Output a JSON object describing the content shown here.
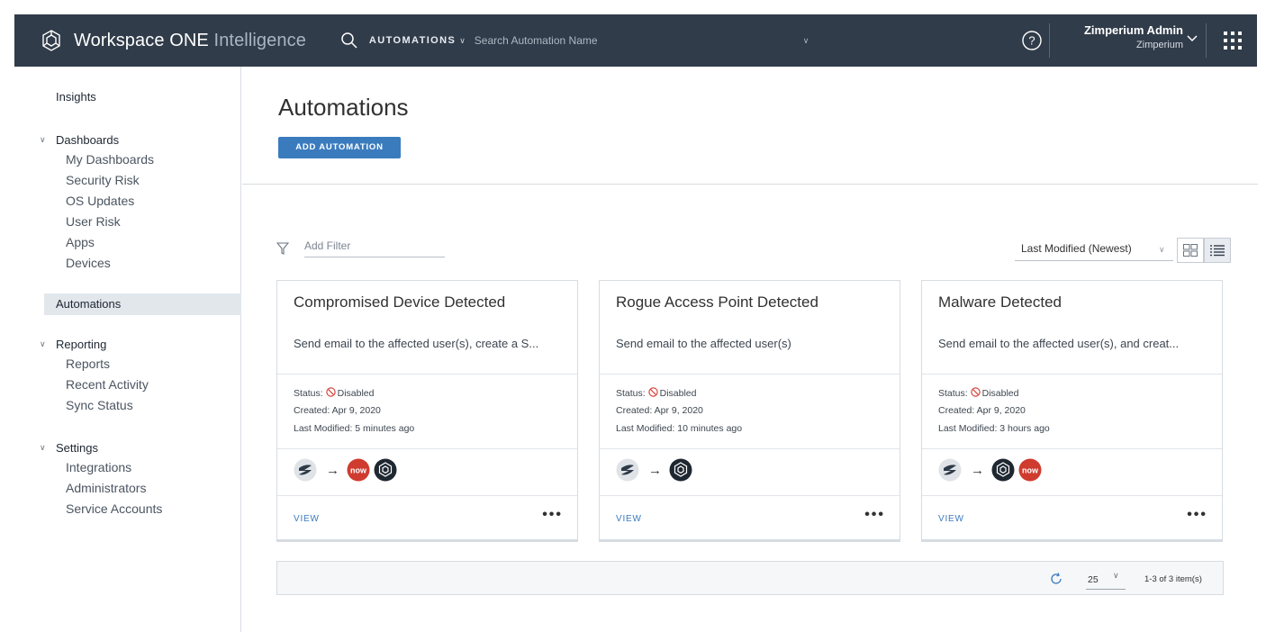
{
  "header": {
    "brand_part1": "Workspace ONE ",
    "brand_part2": "Intelligence",
    "search_scope": "AUTOMATIONS",
    "search_placeholder": "Search Automation Name",
    "user_name": "Zimperium Admin",
    "user_org": "Zimperium",
    "help_icon": "question-circle-icon",
    "apps_icon": "grid-apps-icon"
  },
  "sidebar": {
    "insights": "Insights",
    "dashboards": {
      "label": "Dashboards",
      "items": [
        "My Dashboards",
        "Security Risk",
        "OS Updates",
        "User Risk",
        "Apps",
        "Devices"
      ]
    },
    "automations": "Automations",
    "reporting": {
      "label": "Reporting",
      "items": [
        "Reports",
        "Recent Activity",
        "Sync Status"
      ]
    },
    "settings": {
      "label": "Settings",
      "items": [
        "Integrations",
        "Administrators",
        "Service Accounts"
      ]
    }
  },
  "main": {
    "title": "Automations",
    "add_button": "ADD AUTOMATION",
    "filter_placeholder": "Add Filter",
    "sort_label": "Last Modified (Newest)",
    "cards": [
      {
        "title": "Compromised Device Detected",
        "description": "Send email to the affected user(s), create a S...",
        "status_label": "Status:",
        "status_value": "Disabled",
        "created": "Created: Apr 9, 2020",
        "modified": "Last Modified: 5 minutes ago",
        "flow_icons": [
          "zimperium-icon",
          "servicenow-icon",
          "workspace-one-icon"
        ],
        "view_label": "VIEW",
        "more_label": "•••"
      },
      {
        "title": "Rogue Access Point Detected",
        "description": "Send email to the affected user(s)",
        "status_label": "Status:",
        "status_value": "Disabled",
        "created": "Created: Apr 9, 2020",
        "modified": "Last Modified: 10 minutes ago",
        "flow_icons": [
          "zimperium-icon",
          "workspace-one-icon"
        ],
        "view_label": "VIEW",
        "more_label": "•••"
      },
      {
        "title": "Malware Detected",
        "description": "Send email to the affected user(s), and creat...",
        "status_label": "Status:",
        "status_value": "Disabled",
        "created": "Created: Apr 9, 2020",
        "modified": "Last Modified: 3 hours ago",
        "flow_icons": [
          "zimperium-icon",
          "workspace-one-icon",
          "servicenow-icon"
        ],
        "view_label": "VIEW",
        "more_label": "•••"
      }
    ],
    "footer": {
      "page_size": "25",
      "count": "1-3 of 3 item(s)"
    }
  },
  "colors": {
    "header_bg": "#313c4a",
    "accent": "#3a7bbe",
    "disabled_red": "#d8443c",
    "servicenow_red": "#d0352c"
  }
}
